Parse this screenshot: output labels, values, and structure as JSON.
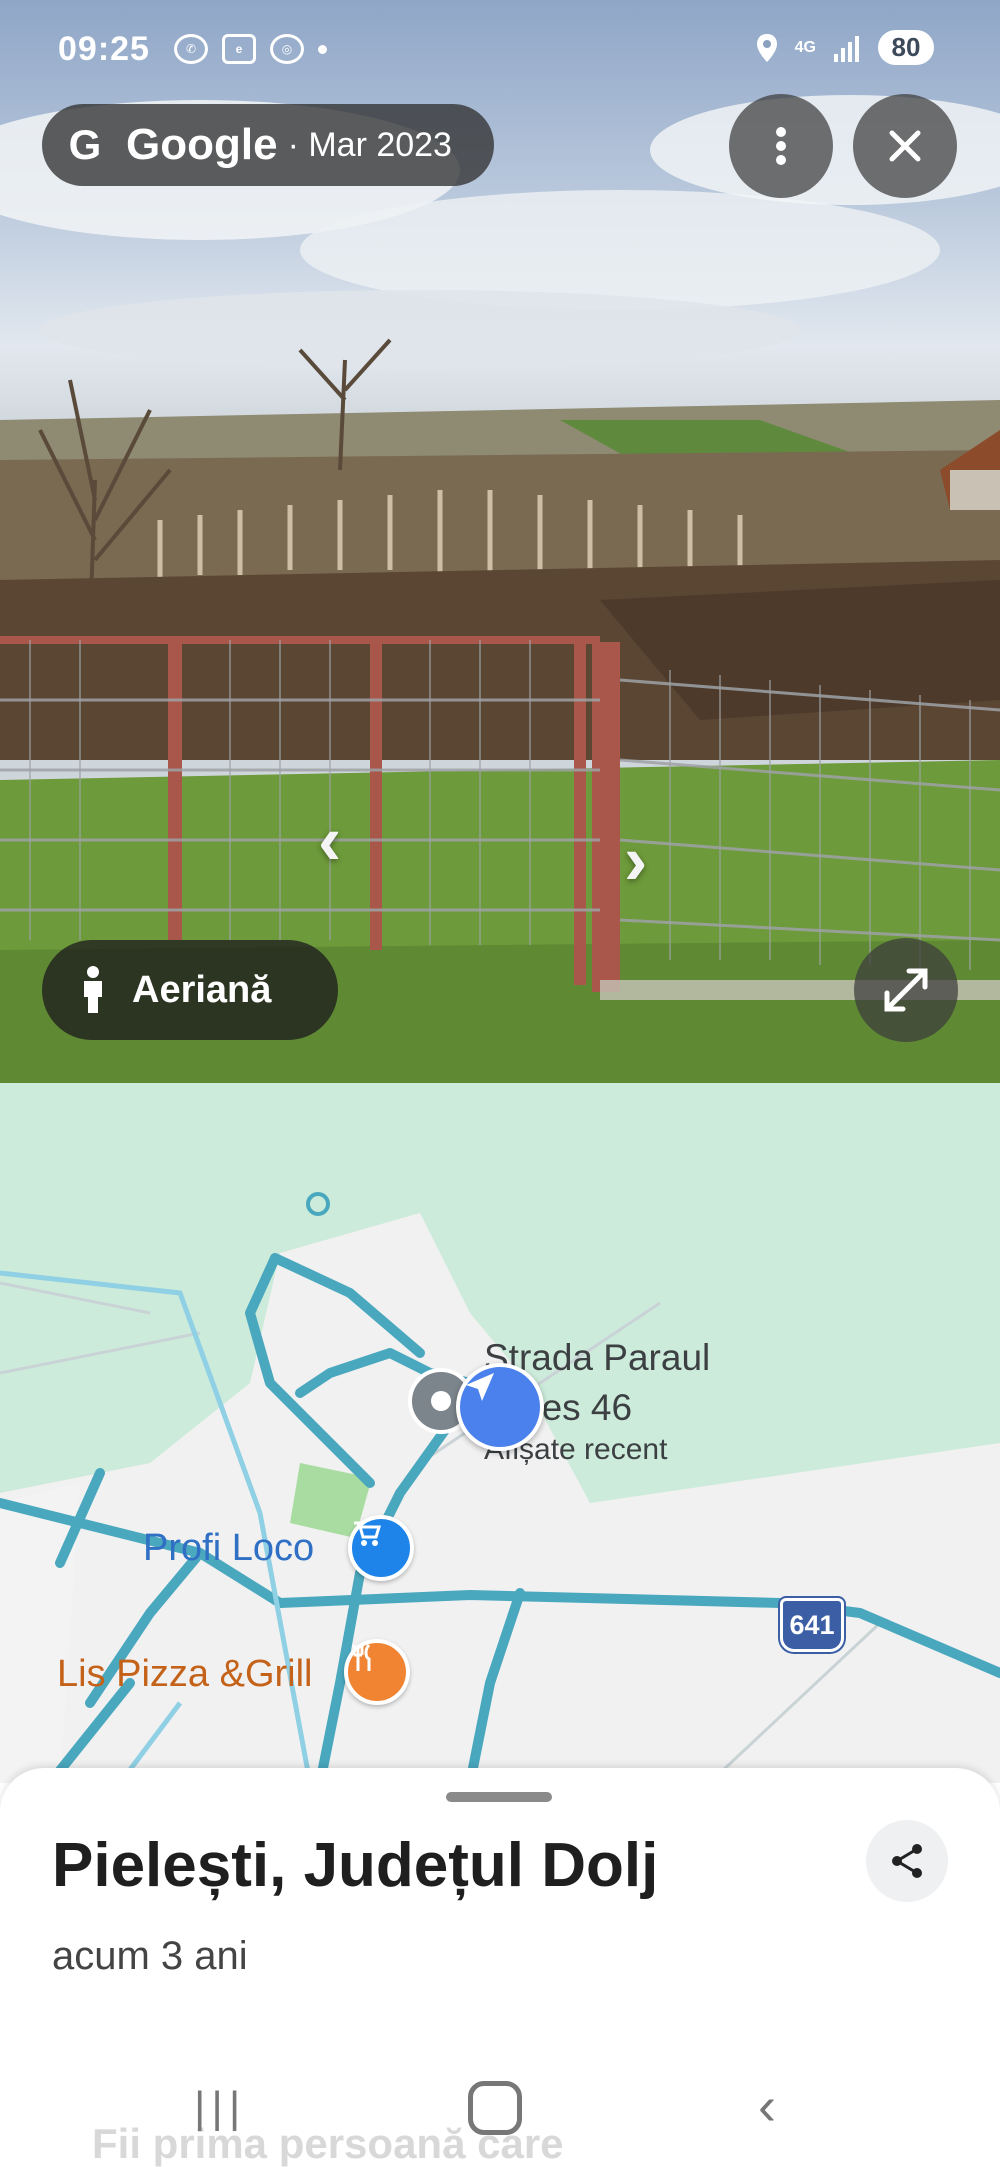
{
  "status_bar": {
    "time": "09:25",
    "app_icons": [
      "whatsapp-icon",
      "emag-icon",
      "chrome-icon"
    ],
    "network": "4G",
    "battery": "80"
  },
  "street_view": {
    "provider": "Google",
    "date": "· Mar 2023",
    "aerial_label": "Aeriană"
  },
  "map": {
    "street_line1": "Strada Paraul",
    "street_line2": "Cotes 46",
    "recent_label": "Afișate recent",
    "poi_shop": "Profi Loco",
    "poi_food": "Lis Pizza &Grill",
    "road_number": "641"
  },
  "place": {
    "title": "Pielești, Județul Dolj",
    "subtitle": "acum 3 ani",
    "faded_text": "Fii prima persoană care"
  },
  "colors": {
    "map_bg": "#cdebda",
    "road": "#5ab4c8",
    "shop_pin": "#1f84ea",
    "food_pin": "#f08433",
    "location_blue": "#4a81ec"
  }
}
